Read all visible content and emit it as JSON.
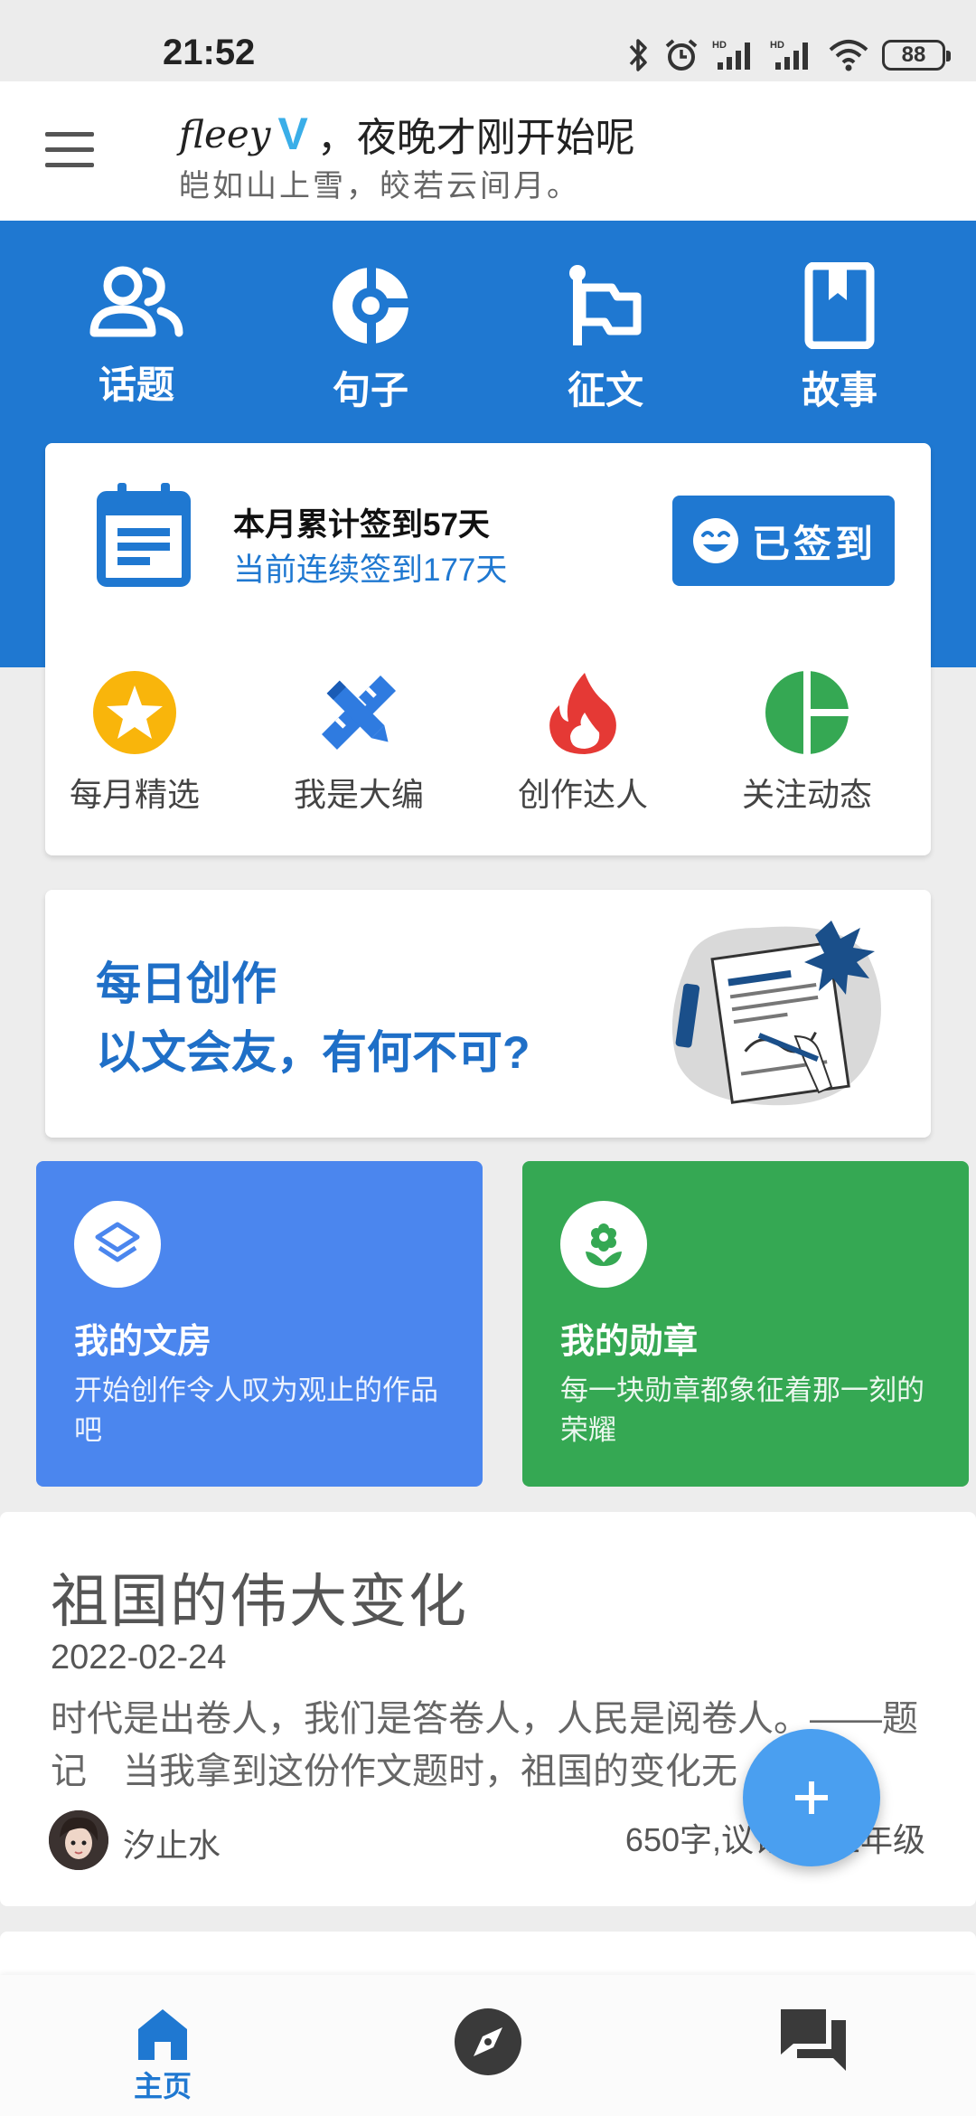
{
  "status_bar": {
    "time": "21:52",
    "battery": "88"
  },
  "header": {
    "username": "fleey",
    "verified_badge": "V",
    "greeting": "，夜晚才刚开始呢",
    "poem": "皑如山上雪，皎若云间月。"
  },
  "top_nav": {
    "items": [
      {
        "label": "话题",
        "icon": "users-icon"
      },
      {
        "label": "句子",
        "icon": "quote-icon"
      },
      {
        "label": "征文",
        "icon": "flag-icon"
      },
      {
        "label": "故事",
        "icon": "book-icon"
      }
    ]
  },
  "signin": {
    "month_text": "本月累计签到57天",
    "streak_text": "当前连续签到177天",
    "button_label": "已签到"
  },
  "features": [
    {
      "label": "每月精选",
      "icon": "star-icon",
      "color": "#f9b50b"
    },
    {
      "label": "我是大编",
      "icon": "pencil-ruler-icon",
      "color": "#2f7be0"
    },
    {
      "label": "创作达人",
      "icon": "fire-icon",
      "color": "#e53935"
    },
    {
      "label": "关注动态",
      "icon": "pie-icon",
      "color": "#35a853"
    }
  ],
  "banner": {
    "line1": "每日创作",
    "line2": "以文会友，有何不可?"
  },
  "tiles": [
    {
      "title": "我的文房",
      "desc": "开始创作令人叹为观止的作品吧",
      "color": "#4b86ee",
      "icon": "layers-icon"
    },
    {
      "title": "我的勋章",
      "desc": "每一块勋章都象征着那一刻的荣耀",
      "color": "#35a853",
      "icon": "flower-icon"
    }
  ],
  "article": {
    "title": "祖国的伟大变化",
    "date": "2022-02-24",
    "excerpt": "时代是出卷人，我们是答卷人，人民是阅卷人。——题记　当我拿到这份作文题时，祖国的变化无",
    "author": "汐止水",
    "meta": "650字,议论文,五年级"
  },
  "bottom_nav": {
    "home_label": "主页",
    "accent": "#1f78d1"
  }
}
